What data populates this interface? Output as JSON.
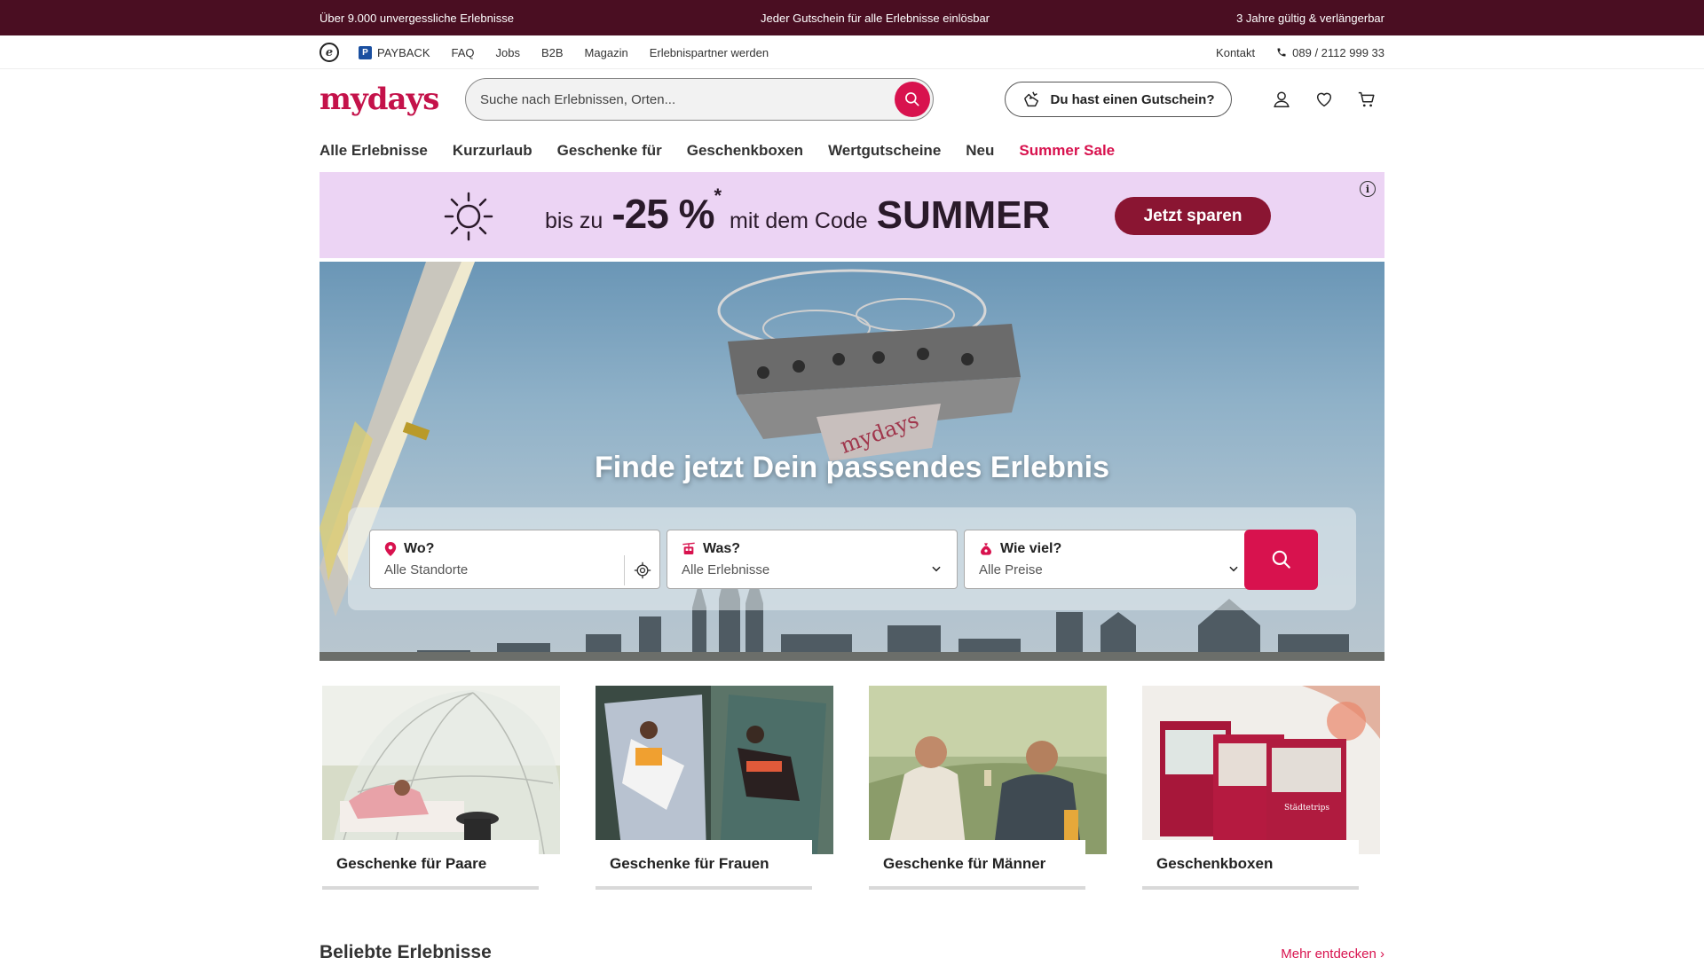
{
  "topbar": {
    "left": "Über 9.000 unvergessliche Erlebnisse",
    "center": "Jeder Gutschein für alle Erlebnisse einlösbar",
    "right": "3 Jahre gültig & verlängerbar"
  },
  "utility": {
    "payback": "PAYBACK",
    "links": [
      "FAQ",
      "Jobs",
      "B2B",
      "Magazin",
      "Erlebnispartner werden"
    ],
    "contact": "Kontakt",
    "phone": "089 / 2112 999 33"
  },
  "header": {
    "logo": "mydays",
    "search_placeholder": "Suche nach Erlebnissen, Orten...",
    "voucher_label": "Du hast einen Gutschein?"
  },
  "nav": {
    "items": [
      "Alle Erlebnisse",
      "Kurzurlaub",
      "Geschenke für",
      "Geschenkboxen",
      "Wertgutscheine",
      "Neu"
    ],
    "sale": "Summer Sale"
  },
  "promo": {
    "prefix": "bis zu",
    "discount": "-25 %",
    "asterisk": "*",
    "middle": "mit dem Code",
    "code": "SUMMER",
    "cta": "Jetzt sparen",
    "accent": "#8a1532",
    "background": "#ecd4f4"
  },
  "hero": {
    "title": "Finde jetzt Dein passendes Erlebnis",
    "finder": {
      "where_label": "Wo?",
      "where_value": "Alle Standorte",
      "what_label": "Was?",
      "what_value": "Alle Erlebnisse",
      "price_label": "Wie viel?",
      "price_value": "Alle Preise"
    }
  },
  "cards": [
    {
      "label": "Geschenke für Paare"
    },
    {
      "label": "Geschenke für Frauen"
    },
    {
      "label": "Geschenke für Männer"
    },
    {
      "label": "Geschenkboxen"
    }
  ],
  "section": {
    "title": "Beliebte Erlebnisse",
    "more": "Mehr entdecken"
  },
  "colors": {
    "brand": "#c4124a",
    "button": "#d8124e",
    "topbar": "#4a0e22"
  }
}
